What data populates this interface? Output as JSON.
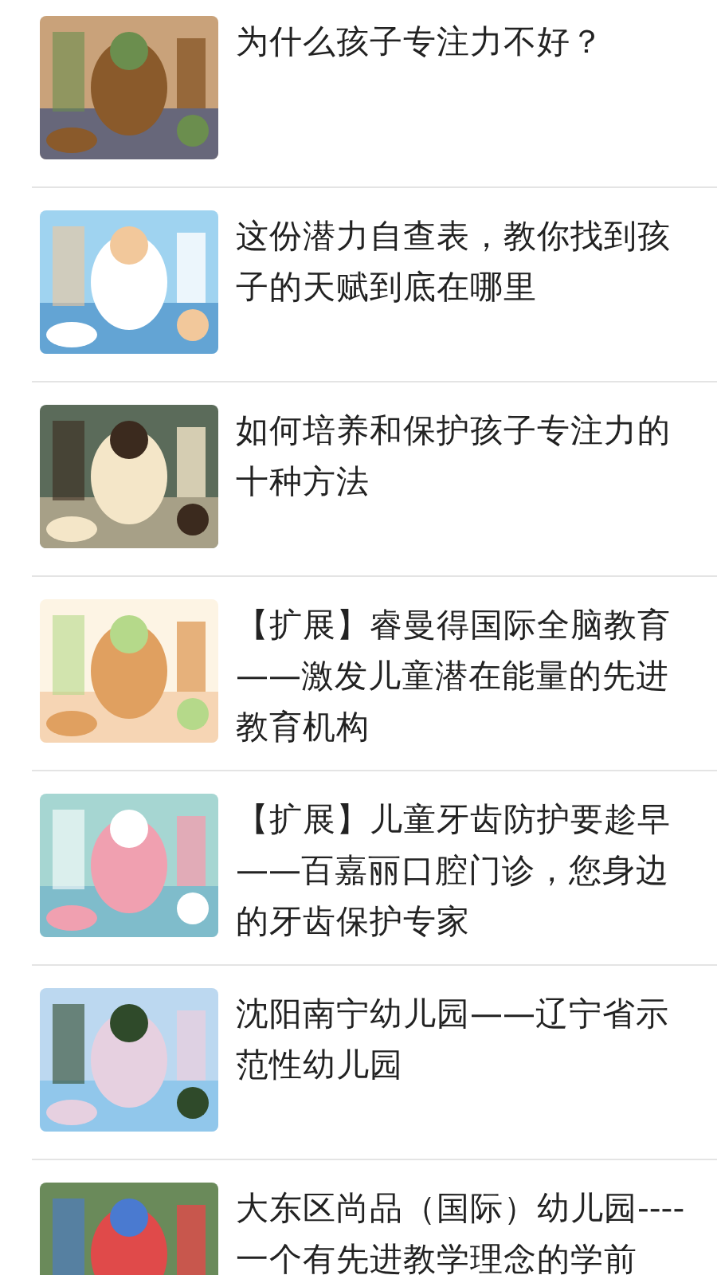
{
  "articles": [
    {
      "title": "为什么孩子专注力不好？"
    },
    {
      "title": "这份潜力自查表，教你找到孩子的天赋到底在哪里"
    },
    {
      "title": "如何培养和保护孩子专注力的十种方法"
    },
    {
      "title": "【扩展】睿曼得国际全脑教育——激发儿童潜在能量的先进教育机构"
    },
    {
      "title": "【扩展】儿童牙齿防护要趁早——百嘉丽口腔门诊，您身边的牙齿保护专家"
    },
    {
      "title": "沈阳南宁幼儿园——辽宁省示范性幼儿园"
    },
    {
      "title": "大东区尚品（国际）幼儿园----一个有先进教学理念的学前"
    }
  ]
}
